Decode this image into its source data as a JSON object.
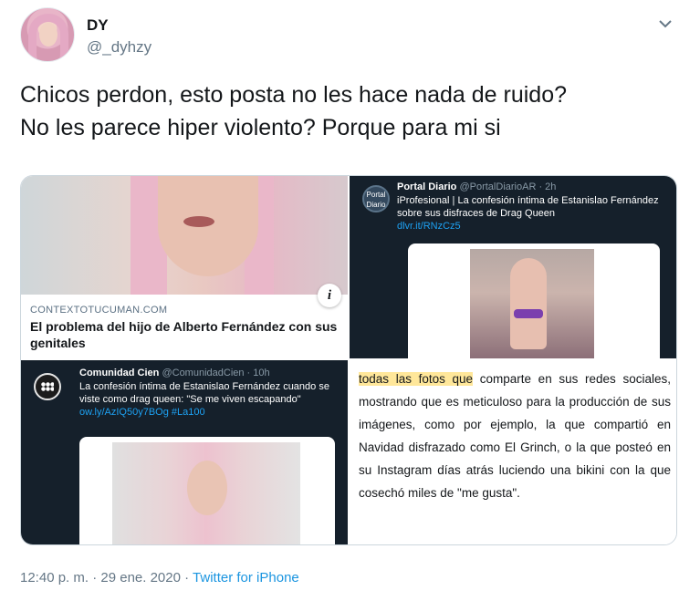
{
  "author": {
    "name": "DY",
    "handle": "@_dyhzy"
  },
  "tweet_lines": [
    "Chicos perdon, esto posta no les hace nada de ruido?",
    "No les parece hiper violento?  Porque para mi si"
  ],
  "media": {
    "panel1": {
      "source": "CONTEXTOTUCUMAN.COM",
      "headline": "El problema del hijo de Alberto Fernández con sus genitales",
      "badge": "i"
    },
    "panel2": {
      "logo_text": "Portal Diario",
      "name": "Portal Diario",
      "handle": "@PortalDiarioAR · 2h",
      "body": "iProfesional | La confesión íntima de Estanislao Fernández sobre sus disfraces de Drag Queen",
      "link": "dlvr.it/RNzCz5"
    },
    "panel3": {
      "name": "Comunidad Cien",
      "handle": "@ComunidadCien · 10h",
      "body": "La confesión íntima de Estanislao Fernández cuando se viste como drag queen: \"Se me viven escapando\"",
      "link": "ow.ly/AzIQ50y7BOg #La100"
    },
    "panel4": {
      "highlight": "todas las fotos que",
      "rest": " comparte en sus redes sociales, mostrando que es meticuloso para la producción de sus imágenes, como por ejemplo, la que compartió en Navidad disfrazado como El Grinch, o la que posteó en su Instagram días atrás luciendo una bikini con la que cosechó miles de \"me gusta\"."
    }
  },
  "footer": {
    "time": "12:40 p. m. · 29 ene. 2020 · ",
    "source": "Twitter for iPhone"
  },
  "colors": {
    "link": "#1b95e0",
    "dark_panel": "#15202b",
    "highlight": "#ffe79a"
  },
  "icons": {
    "caret": "chevron-down-icon"
  }
}
